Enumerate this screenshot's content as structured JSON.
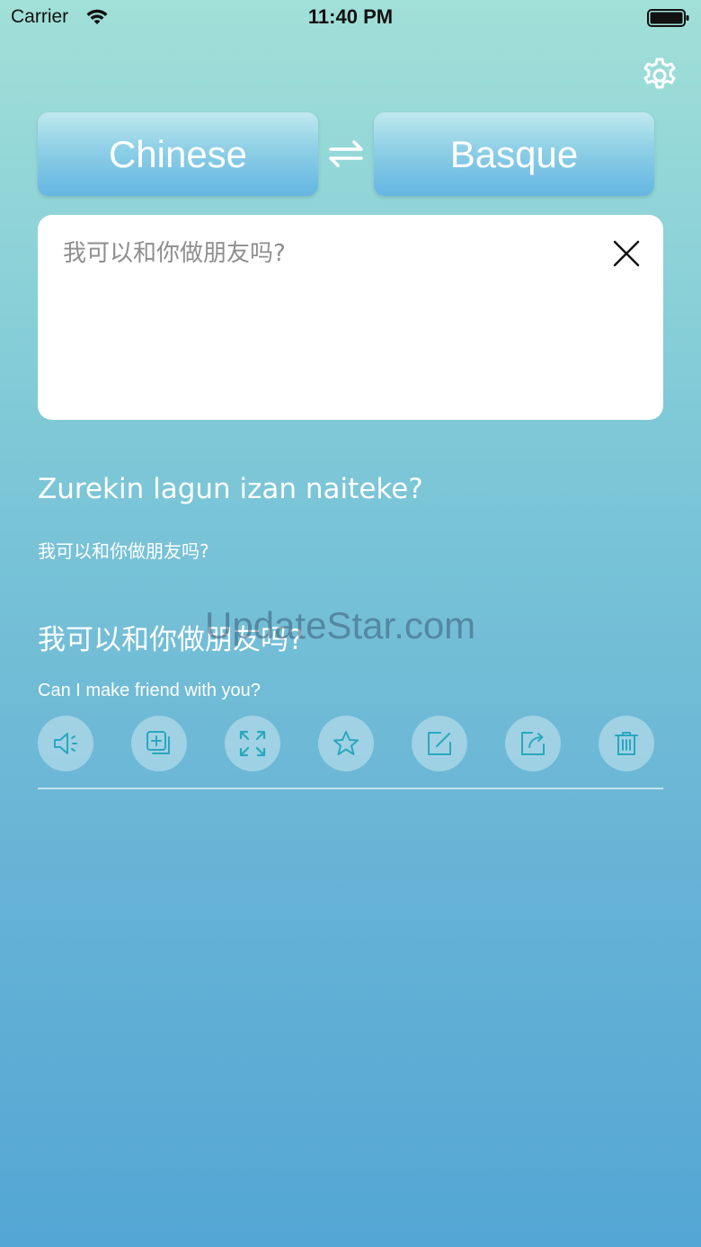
{
  "status_bar": {
    "carrier": "Carrier",
    "time": "11:40 PM"
  },
  "languages": {
    "source": "Chinese",
    "target": "Basque"
  },
  "input": {
    "text": "我可以和你做朋友吗?"
  },
  "results": [
    {
      "main": "Zurekin lagun izan naiteke?",
      "sub": "我可以和你做朋友吗?"
    },
    {
      "main": "我可以和你做朋友吗?",
      "sub": "Can I make friend with you?"
    }
  ],
  "watermark": "UpdateStar.com",
  "actions": [
    {
      "icon": "speaker-icon"
    },
    {
      "icon": "copy-icon"
    },
    {
      "icon": "expand-icon"
    },
    {
      "icon": "star-icon"
    },
    {
      "icon": "edit-icon"
    },
    {
      "icon": "share-icon"
    },
    {
      "icon": "trash-icon"
    }
  ],
  "colors": {
    "accent": "#1aa0b8",
    "background_top": "#a1e0d8",
    "background_bottom": "#54a6d4"
  }
}
